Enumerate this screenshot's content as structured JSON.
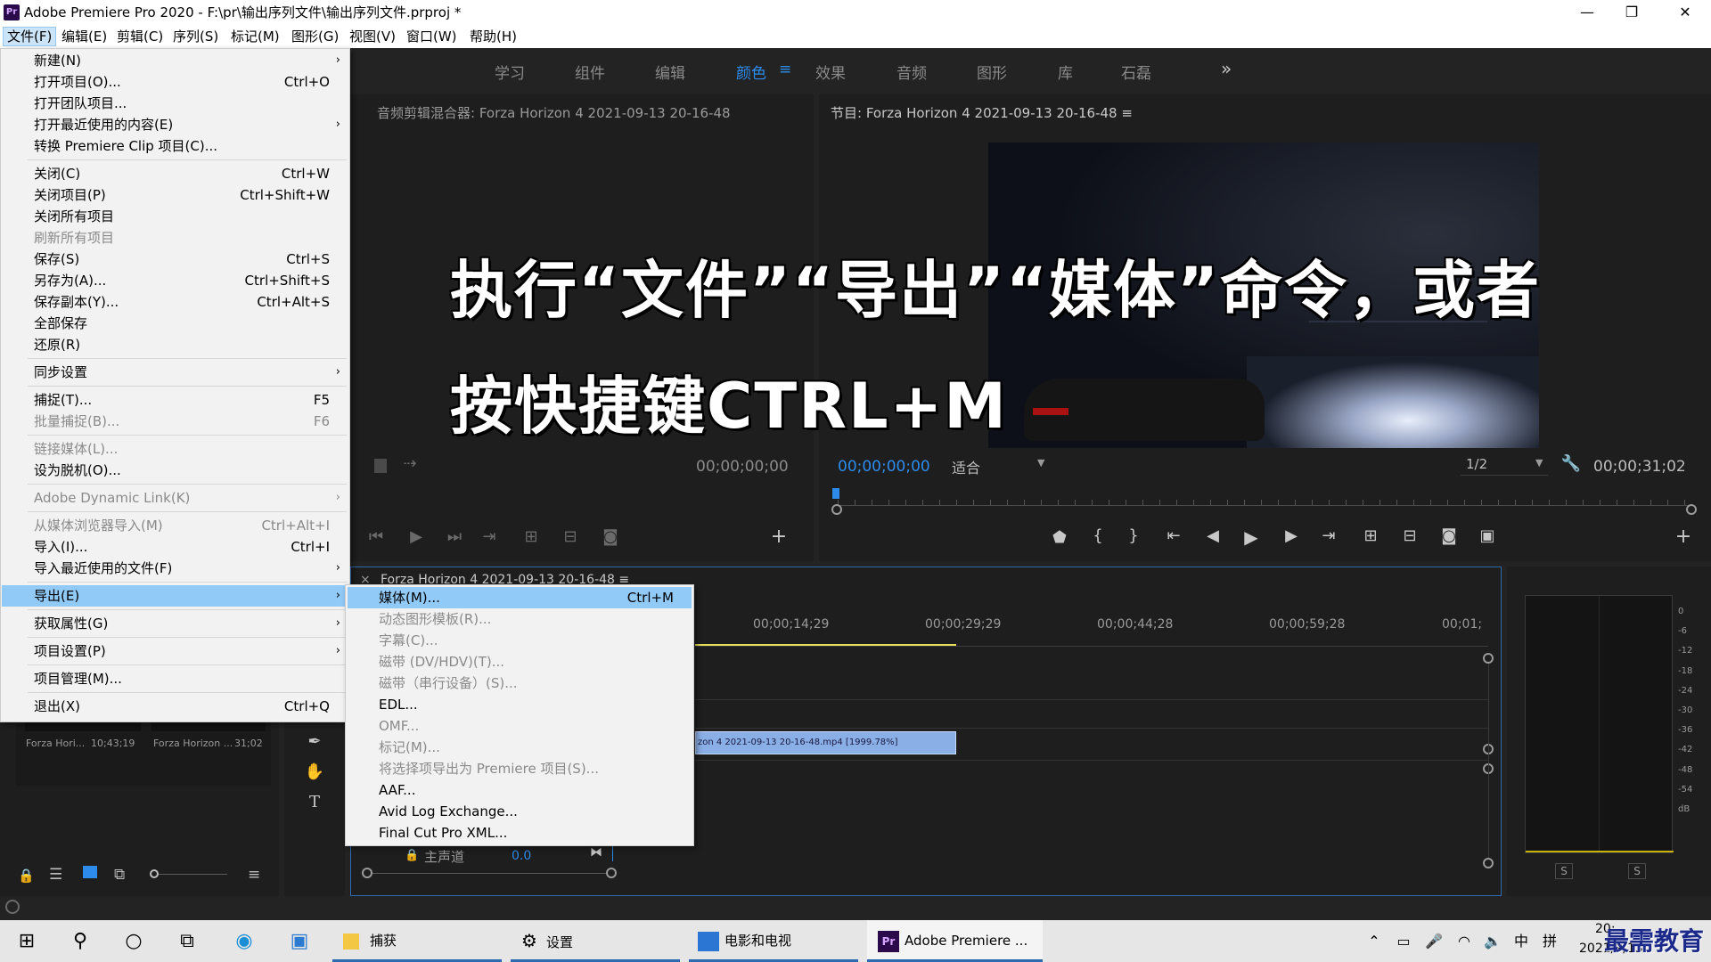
{
  "window": {
    "title": "Adobe Premiere Pro 2020 - F:\\pr\\输出序列文件\\输出序列文件.prproj *",
    "app_icon": "Pr"
  },
  "menubar": [
    "文件(F)",
    "编辑(E)",
    "剪辑(C)",
    "序列(S)",
    "标记(M)",
    "图形(G)",
    "视图(V)",
    "窗口(W)",
    "帮助(H)"
  ],
  "workspaces": [
    "学习",
    "组件",
    "编辑",
    "颜色",
    "效果",
    "音频",
    "图形",
    "库",
    "石磊"
  ],
  "workspace_menu_icon": "≡",
  "workspace_overflow": "»",
  "source_panel": {
    "title": "音频剪辑混合器: Forza Horizon 4 2021-09-13 20-16-48",
    "timecode": "00;00;00;00"
  },
  "program_panel": {
    "title": "节目: Forza Horizon 4 2021-09-13 20-16-48 ≡",
    "timecode": "00;00;00;00",
    "fit": "适合",
    "resolution": "1/2",
    "duration": "00;00;31;02"
  },
  "timeline": {
    "tab": "Forza Horizon 4 2021-09-13 20-16-48 ≡",
    "close": "×",
    "ruler": [
      "00;00;14;29",
      "00;00;29;29",
      "00;00;44;28",
      "00;00;59;28",
      "00;01;"
    ],
    "clip": "zon 4 2021-09-13 20-16-48.mp4 [1999.78%]",
    "master_label": "主声道",
    "master_value": "0.0"
  },
  "project_panel": {
    "items": [
      {
        "name": "Forza Hori...",
        "duration": "10;43;19"
      },
      {
        "name": "Forza Horizon ...",
        "duration": "31;02"
      }
    ]
  },
  "meter": {
    "scale": [
      "0",
      "-6",
      "-12",
      "-18",
      "-24",
      "-30",
      "-36",
      "-42",
      "-48",
      "-54",
      "dB"
    ],
    "solo": [
      "S",
      "S"
    ]
  },
  "file_menu": {
    "items": [
      {
        "label": "新建(N)",
        "shortcut": "",
        "arrow": true,
        "disabled": false
      },
      {
        "label": "打开项目(O)...",
        "shortcut": "Ctrl+O",
        "arrow": false,
        "disabled": false
      },
      {
        "label": "打开团队项目...",
        "shortcut": "",
        "arrow": false,
        "disabled": false
      },
      {
        "label": "打开最近使用的内容(E)",
        "shortcut": "",
        "arrow": true,
        "disabled": false
      },
      {
        "label": "转换 Premiere Clip 项目(C)...",
        "shortcut": "",
        "arrow": false,
        "disabled": false
      },
      {
        "label": "关闭(C)",
        "shortcut": "Ctrl+W",
        "arrow": false,
        "disabled": false
      },
      {
        "label": "关闭项目(P)",
        "shortcut": "Ctrl+Shift+W",
        "arrow": false,
        "disabled": false
      },
      {
        "label": "关闭所有项目",
        "shortcut": "",
        "arrow": false,
        "disabled": false
      },
      {
        "label": "刷新所有项目",
        "shortcut": "",
        "arrow": false,
        "disabled": true
      },
      {
        "label": "保存(S)",
        "shortcut": "Ctrl+S",
        "arrow": false,
        "disabled": false
      },
      {
        "label": "另存为(A)...",
        "shortcut": "Ctrl+Shift+S",
        "arrow": false,
        "disabled": false
      },
      {
        "label": "保存副本(Y)...",
        "shortcut": "Ctrl+Alt+S",
        "arrow": false,
        "disabled": false
      },
      {
        "label": "全部保存",
        "shortcut": "",
        "arrow": false,
        "disabled": false
      },
      {
        "label": "还原(R)",
        "shortcut": "",
        "arrow": false,
        "disabled": false
      },
      {
        "label": "同步设置",
        "shortcut": "",
        "arrow": true,
        "disabled": false
      },
      {
        "label": "捕捉(T)...",
        "shortcut": "F5",
        "arrow": false,
        "disabled": false
      },
      {
        "label": "批量捕捉(B)...",
        "shortcut": "F6",
        "arrow": false,
        "disabled": true
      },
      {
        "label": "链接媒体(L)...",
        "shortcut": "",
        "arrow": false,
        "disabled": true
      },
      {
        "label": "设为脱机(O)...",
        "shortcut": "",
        "arrow": false,
        "disabled": false
      },
      {
        "label": "Adobe Dynamic Link(K)",
        "shortcut": "",
        "arrow": true,
        "disabled": true
      },
      {
        "label": "从媒体浏览器导入(M)",
        "shortcut": "Ctrl+Alt+I",
        "arrow": false,
        "disabled": true
      },
      {
        "label": "导入(I)...",
        "shortcut": "Ctrl+I",
        "arrow": false,
        "disabled": false
      },
      {
        "label": "导入最近使用的文件(F)",
        "shortcut": "",
        "arrow": true,
        "disabled": false
      },
      {
        "label": "导出(E)",
        "shortcut": "",
        "arrow": true,
        "disabled": false,
        "highlight": true
      },
      {
        "label": "获取属性(G)",
        "shortcut": "",
        "arrow": true,
        "disabled": false
      },
      {
        "label": "项目设置(P)",
        "shortcut": "",
        "arrow": true,
        "disabled": false
      },
      {
        "label": "项目管理(M)...",
        "shortcut": "",
        "arrow": false,
        "disabled": false
      },
      {
        "label": "退出(X)",
        "shortcut": "Ctrl+Q",
        "arrow": false,
        "disabled": false
      }
    ]
  },
  "export_submenu": {
    "items": [
      {
        "label": "媒体(M)...",
        "shortcut": "Ctrl+M",
        "disabled": false,
        "highlight": true
      },
      {
        "label": "动态图形模板(R)...",
        "shortcut": "",
        "disabled": true
      },
      {
        "label": "字幕(C)...",
        "shortcut": "",
        "disabled": true
      },
      {
        "label": "磁带 (DV/HDV)(T)...",
        "shortcut": "",
        "disabled": true
      },
      {
        "label": "磁带（串行设备）(S)...",
        "shortcut": "",
        "disabled": true
      },
      {
        "label": "EDL...",
        "shortcut": "",
        "disabled": false
      },
      {
        "label": "OMF...",
        "shortcut": "",
        "disabled": true
      },
      {
        "label": "标记(M)...",
        "shortcut": "",
        "disabled": true
      },
      {
        "label": "将选择项导出为 Premiere 项目(S)...",
        "shortcut": "",
        "disabled": true
      },
      {
        "label": "AAF...",
        "shortcut": "",
        "disabled": false
      },
      {
        "label": "Avid Log Exchange...",
        "shortcut": "",
        "disabled": false
      },
      {
        "label": "Final Cut Pro XML...",
        "shortcut": "",
        "disabled": false
      }
    ]
  },
  "overlay": {
    "line1": "执行“文件”“导出”“媒体”命令，或者",
    "line2": "按快捷键CTRL+M"
  },
  "taskbar": {
    "apps": [
      {
        "label": "捕获"
      },
      {
        "label": "设置"
      },
      {
        "label": "电影和电视"
      },
      {
        "label": "Adobe Premiere ..."
      }
    ],
    "ime": "中",
    "ime2": "拼",
    "clock_time": "20:",
    "date": "2021/9/13",
    "watermark": "最需教育"
  },
  "colors": {
    "accent": "#2d8ceb",
    "menu_highlight": "#91c9f7",
    "playhead": "#e8e05a"
  }
}
